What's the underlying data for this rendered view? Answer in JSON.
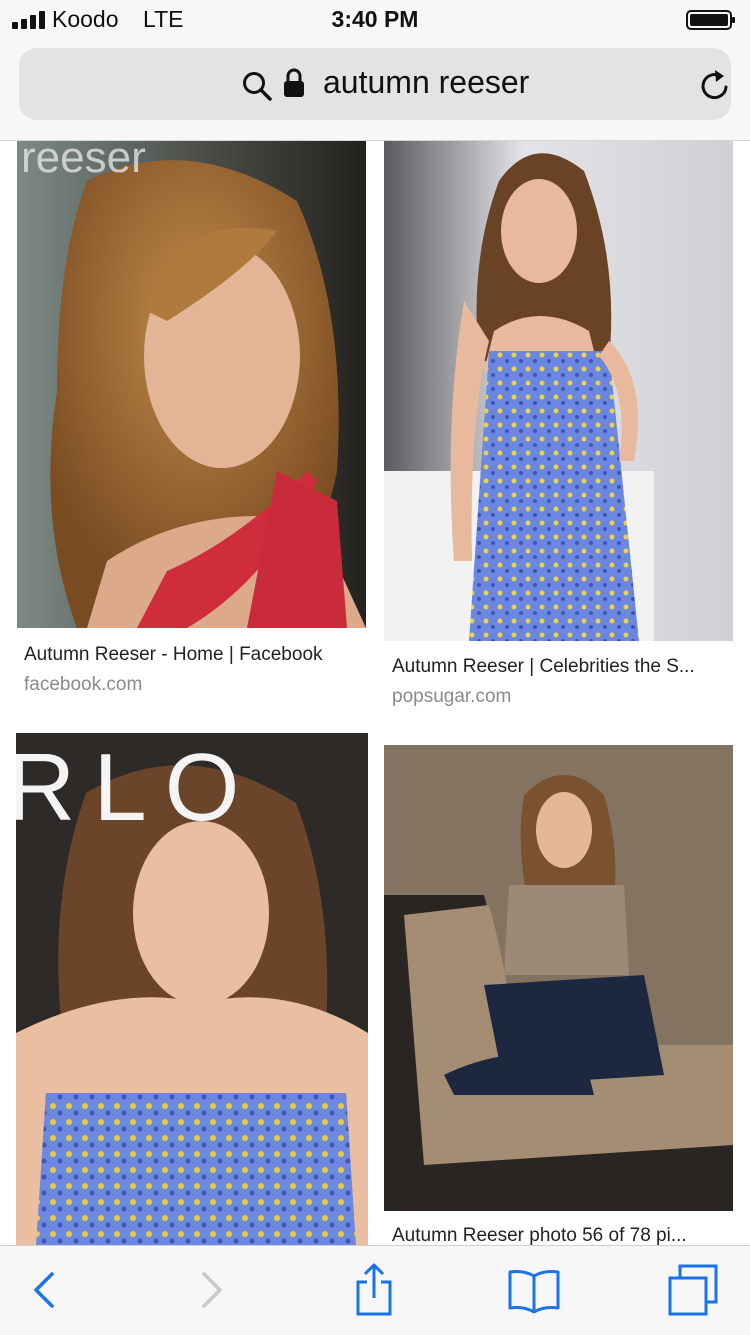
{
  "status_bar": {
    "carrier": "Koodo",
    "network": "LTE",
    "time": "3:40 PM"
  },
  "url_bar": {
    "text": "autumn reeser",
    "icons": [
      "search-icon",
      "lock-icon",
      "reload-icon"
    ]
  },
  "results": [
    {
      "title": "Autumn Reeser - Home | Facebook",
      "source": "facebook.com",
      "watermark": "reeser"
    },
    {
      "title": "Autumn Reeser | Celebrities the S...",
      "source": "popsugar.com"
    },
    {
      "title": "",
      "source": "",
      "watermark": "RLO"
    },
    {
      "title": "Autumn Reeser photo 56 of 78 pi...",
      "source": ""
    }
  ],
  "toolbar": {
    "icons": [
      "back-icon",
      "forward-icon",
      "share-icon",
      "bookmarks-icon",
      "tabs-icon"
    ]
  },
  "colors": {
    "accent": "#1a73e8",
    "disabled": "#c7c7cc",
    "bar_bg": "#f7f7f7",
    "url_field_bg": "#e3e3e6"
  }
}
